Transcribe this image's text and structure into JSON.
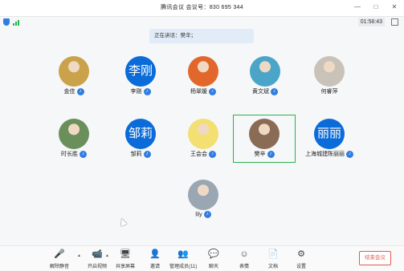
{
  "window": {
    "title": "腾讯会议 会议号：830 695 344",
    "minimize": "—",
    "maximize": "□",
    "close": "✕"
  },
  "status": {
    "clock": "01:58:43"
  },
  "speaking": "正在讲话：樊辛；",
  "participants": [
    {
      "name": "金佳",
      "avatar_text": "",
      "avatar_color": "#c9a24a",
      "mic_on": true
    },
    {
      "name": "李刚",
      "avatar_text": "李刚",
      "avatar_color": "#0a6bd9",
      "mic_on": true
    },
    {
      "name": "杨翠媛",
      "avatar_text": "",
      "avatar_color": "#e2672b",
      "mic_on": true
    },
    {
      "name": "黄文斌",
      "avatar_text": "",
      "avatar_color": "#4aa5c8",
      "mic_on": true
    },
    {
      "name": "何睿萍",
      "avatar_text": "",
      "avatar_color": "#c9c2b8",
      "mic_on": false
    },
    {
      "name": "时长胜",
      "avatar_text": "",
      "avatar_color": "#6a8f5a",
      "mic_on": true
    },
    {
      "name": "邹莉",
      "avatar_text": "邹莉",
      "avatar_color": "#0a6bd9",
      "mic_on": true
    },
    {
      "name": "王会会",
      "avatar_text": "",
      "avatar_color": "#f3df72",
      "mic_on": true
    },
    {
      "name": "樊辛",
      "avatar_text": "",
      "avatar_color": "#8a6b55",
      "mic_on": true
    },
    {
      "name": "上海城建陈丽丽",
      "avatar_text": "丽丽",
      "avatar_color": "#0a6bd9",
      "mic_on": true
    },
    {
      "name": "lily",
      "avatar_text": "",
      "avatar_color": "#9aa7b3",
      "mic_on": true
    }
  ],
  "toolbar": {
    "items": [
      {
        "label": "解除静音",
        "icon": "🎤"
      },
      {
        "label": "开启视频",
        "icon": "📹"
      },
      {
        "label": "共享屏幕",
        "icon": "🖥"
      },
      {
        "label": "邀请",
        "icon": "👤"
      },
      {
        "label": "管理成员(11)",
        "icon": "👥"
      },
      {
        "label": "聊天",
        "icon": "💬"
      },
      {
        "label": "表情",
        "icon": "☺"
      },
      {
        "label": "文档",
        "icon": "📄"
      },
      {
        "label": "设置",
        "icon": "⚙"
      }
    ],
    "end_meeting": "结束会议"
  },
  "colors": {
    "accent": "#0a6bd9",
    "speaking_border": "#2bb24c",
    "end_button": "#e05a4f"
  }
}
